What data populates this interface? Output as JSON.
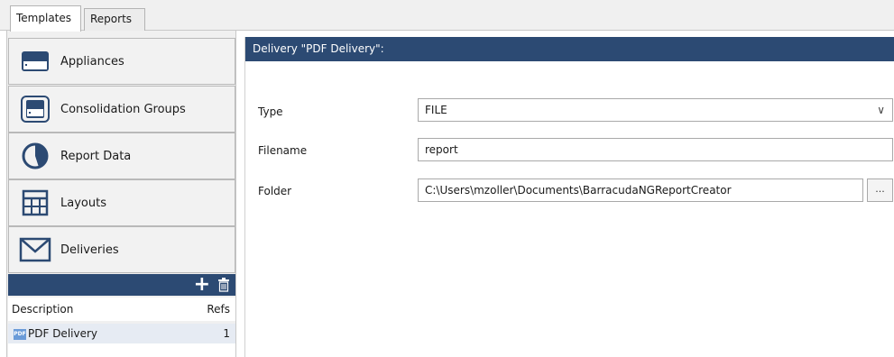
{
  "tabs": [
    {
      "label": "Templates",
      "active": true
    },
    {
      "label": "Reports",
      "active": false
    }
  ],
  "nav": [
    {
      "label": "Appliances",
      "icon": "appliance-icon"
    },
    {
      "label": "Consolidation Groups",
      "icon": "consolidation-group-icon"
    },
    {
      "label": "Report Data",
      "icon": "pie-chart-icon"
    },
    {
      "label": "Layouts",
      "icon": "grid-layout-icon"
    },
    {
      "label": "Deliveries",
      "icon": "envelope-icon"
    }
  ],
  "list": {
    "columns": [
      "Description",
      "Refs"
    ],
    "rows": [
      {
        "icon_text": "PDF",
        "name": "PDF Delivery",
        "refs": "1"
      }
    ]
  },
  "panel": {
    "header": "Delivery \"PDF Delivery\":",
    "fields": {
      "type_label": "Type",
      "type_value": "FILE",
      "filename_label": "Filename",
      "filename_value": "report",
      "folder_label": "Folder",
      "folder_value": "C:\\Users\\mzoller\\Documents\\BarracudaNGReportCreator",
      "browse_label": "..."
    }
  },
  "colors": {
    "header_bg": "#2c4a73",
    "accent_icon": "#2c4a73"
  }
}
